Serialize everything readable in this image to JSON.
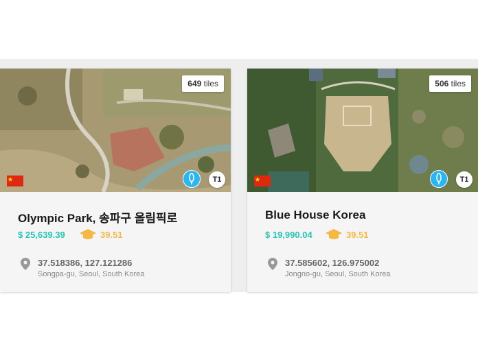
{
  "cards": [
    {
      "tiles_count": "649",
      "tiles_label": "tiles",
      "title": "Olympic Park, 송파구 올림픽로",
      "price": "$ 25,639.39",
      "score": "39.51",
      "coords": "37.518386, 127.121286",
      "address": "Songpa-gu, Seoul, South Korea",
      "tier": "T1",
      "flag": "china-flag-icon"
    },
    {
      "tiles_count": "506",
      "tiles_label": "tiles",
      "title": "Blue House Korea",
      "price": "$ 19,990.04",
      "score": "39.51",
      "coords": "37.585602, 126.975002",
      "address": "Jongno-gu, Seoul, South Korea",
      "tier": "T1",
      "flag": "china-flag-icon"
    }
  ],
  "colors": {
    "price": "#26c6b0",
    "score": "#f5b942",
    "badge_pin": "#29b6f6",
    "flag_red": "#de2910",
    "flag_star": "#ffde00"
  }
}
